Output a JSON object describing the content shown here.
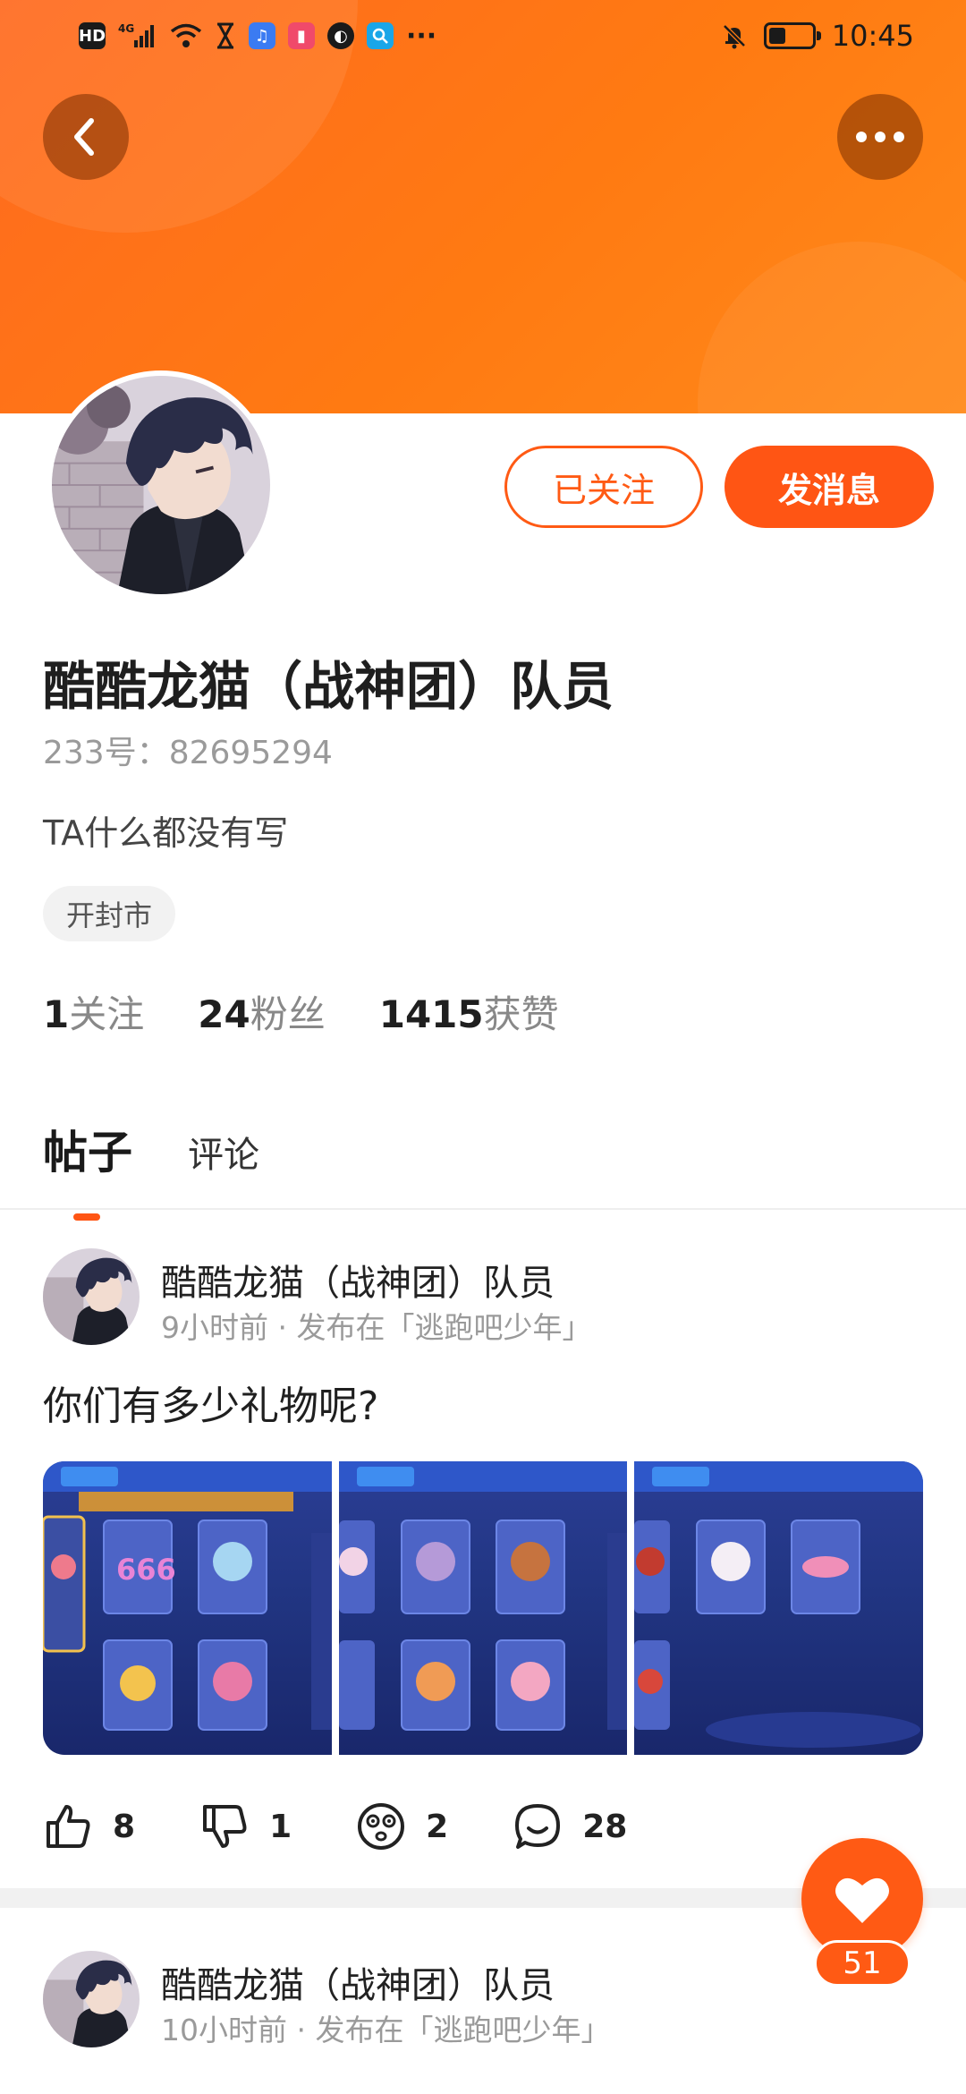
{
  "status_bar": {
    "network": "4G",
    "hd": "HD",
    "more": "···",
    "time": "10:45",
    "battery_level": 0.4,
    "icons": [
      "hd-icon",
      "signal-icon",
      "wifi-icon",
      "hourglass-icon",
      "music-icon",
      "book-icon",
      "globe-icon",
      "search-app-icon",
      "mute-bell-icon",
      "battery-icon"
    ]
  },
  "header": {
    "back_icon": "chevron-left-icon",
    "more_icon": "more-dots-icon",
    "accent": "#ff6a1f"
  },
  "profile": {
    "follow_label": "已关注",
    "message_label": "发消息",
    "name": "酷酷龙猫（战神团）队员",
    "id_text": "233号：82695294",
    "bio": "TA什么都没有写",
    "location": "开封市",
    "stats": [
      {
        "num": "1",
        "label": "关注"
      },
      {
        "num": "24",
        "label": "粉丝"
      },
      {
        "num": "1415",
        "label": "获赞"
      }
    ]
  },
  "tabs": [
    {
      "label": "帖子",
      "active": true
    },
    {
      "label": "评论",
      "active": false
    }
  ],
  "posts": [
    {
      "author": "酷酷龙猫（战神团）队员",
      "meta": "9小时前 · 发布在「逃跑吧少年」",
      "text": "你们有多少礼物呢?",
      "actions": [
        {
          "icon": "thumbs-up-icon",
          "count": "8"
        },
        {
          "icon": "thumbs-down-icon",
          "count": "1"
        },
        {
          "icon": "dizzy-face-icon",
          "count": "2"
        },
        {
          "icon": "comment-icon",
          "count": "28"
        }
      ]
    },
    {
      "author": "酷酷龙猫（战神团）队员",
      "meta": "10小时前 · 发布在「逃跑吧少年」"
    }
  ],
  "fab": {
    "icon": "heart-icon",
    "count": "51"
  }
}
